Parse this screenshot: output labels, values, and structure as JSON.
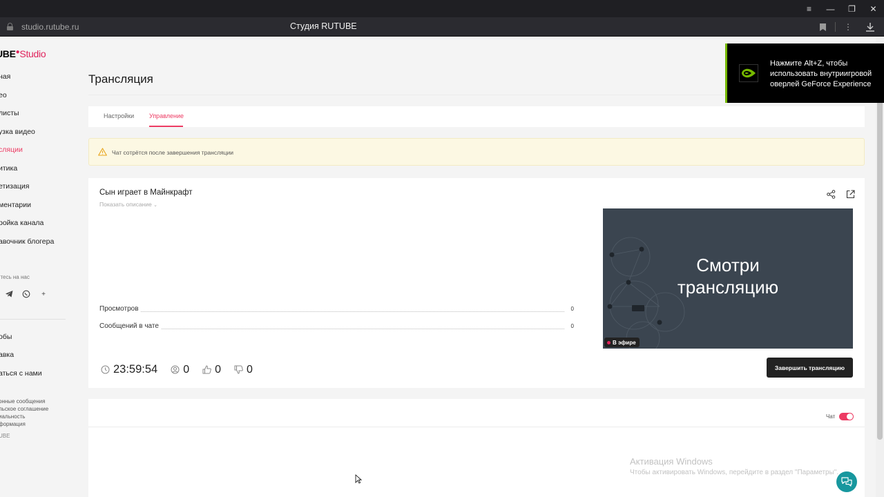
{
  "browser": {
    "url": "studio.rutube.ru",
    "page_title": "Студия RUTUBE"
  },
  "sidebar": {
    "logo_main": "UBE",
    "logo_studio": "Studio",
    "items": [
      {
        "label": "ная",
        "active": false
      },
      {
        "label": "ео",
        "active": false
      },
      {
        "label": "листы",
        "active": false
      },
      {
        "label": "узка видео",
        "active": false
      },
      {
        "label": "сляции",
        "active": true
      },
      {
        "label": "итика",
        "active": false
      },
      {
        "label": "етизация",
        "active": false
      },
      {
        "label": "ментарии",
        "active": false
      },
      {
        "label": "ройка канала",
        "active": false
      },
      {
        "label": "авочник блогера",
        "active": false
      }
    ],
    "social_title": "йтесь на нас",
    "footer_links": [
      "обы",
      "авка",
      "аться с нами"
    ],
    "legal_links": [
      "онные сообщения",
      "льское соглашение",
      "иальность",
      "формация",
      "UBE"
    ]
  },
  "main": {
    "page_title": "Трансляция",
    "tabs": [
      {
        "label": "Настройки",
        "active": false
      },
      {
        "label": "Управление",
        "active": true
      }
    ],
    "alert": "Чат сотрётся после завершения трансляции",
    "stream": {
      "title": "Сын играет в Майнкрафт",
      "show_description": "Показать описание",
      "stats": [
        {
          "label": "Просмотров",
          "value": "0"
        },
        {
          "label": "Сообщений в чате",
          "value": "0"
        }
      ],
      "preview_text_line1": "Смотри",
      "preview_text_line2": "трансляцию",
      "live_badge": "В эфире",
      "timer": "23:59:54",
      "viewers": "0",
      "likes": "0",
      "dislikes": "0",
      "end_button": "Завершить трансляцию"
    },
    "chat": {
      "label": "Чат",
      "enabled": true
    }
  },
  "overlay": {
    "geforce_text": "Нажмите Alt+Z, чтобы использовать внутриигровой оверлей GeForce Experience"
  },
  "windows_activation": {
    "title": "Активация Windows",
    "subtitle": "Чтобы активировать Windows, перейдите в раздел \"Параметры\"."
  },
  "colors": {
    "accent": "#ed3b63",
    "brand_red": "#e0235c",
    "nvidia_green": "#76b900",
    "support_teal": "#17979e",
    "preview_bg": "#3b4550"
  }
}
